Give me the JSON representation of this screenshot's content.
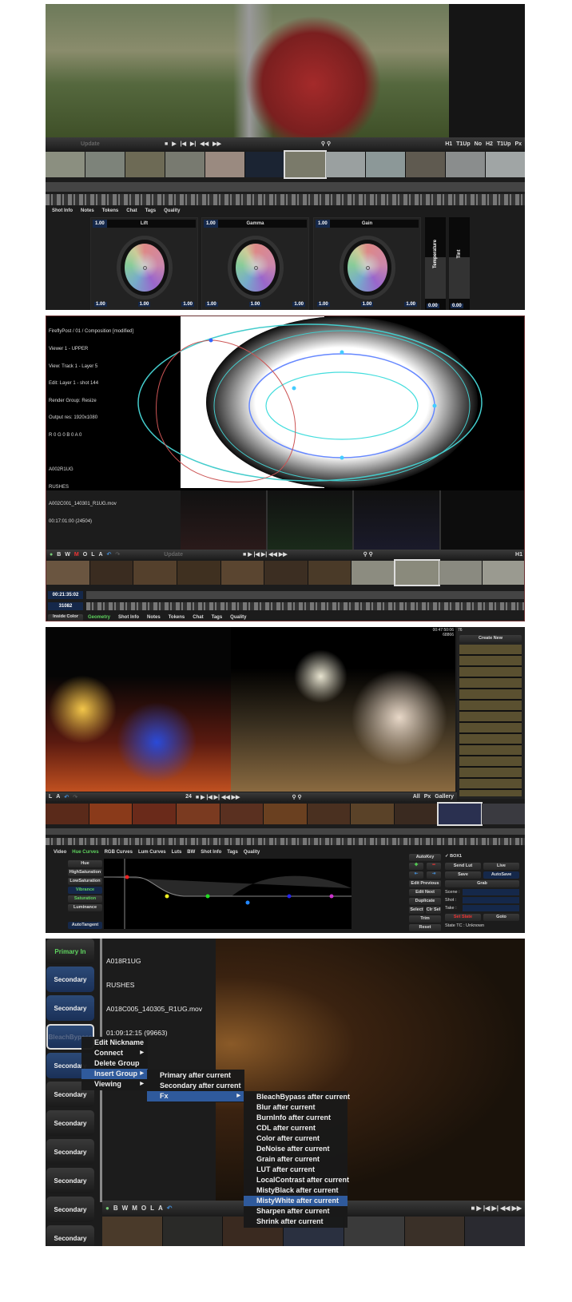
{
  "panel1": {
    "transport": [
      "■",
      "▶",
      "|◀",
      "▶|",
      "◀◀",
      "▶▶"
    ],
    "right_controls": [
      "H1",
      "T1Up",
      "No",
      "H2",
      "T1Up",
      "Px"
    ],
    "update_label": "Update",
    "tabs": [
      "Shot Info",
      "Notes",
      "Tokens",
      "Chat",
      "Tags",
      "Quality"
    ],
    "wheels": [
      {
        "title": "Lift",
        "value": "1.00",
        "r": "1.00",
        "g": "1.00",
        "b": "1.00"
      },
      {
        "title": "Gamma",
        "value": "1.00",
        "r": "1.00",
        "g": "1.00",
        "b": "1.00"
      },
      {
        "title": "Gain",
        "value": "1.00",
        "r": "1.00",
        "g": "1.00",
        "b": "1.00"
      }
    ],
    "sliders": [
      {
        "label": "Temperature",
        "value": "0.00"
      },
      {
        "label": "Tint",
        "value": "0.00"
      }
    ]
  },
  "panel2": {
    "info": [
      "FireflyPost / 01 / Composition [modified]",
      "Viewer 1 - UPPER",
      "View: Track 1 - Layer 5",
      "Edit: Layer 1 - shot 144",
      "Render Group: Resize",
      "Output res: 1920x1080",
      "R 0 G 0 B 0 A 0",
      "",
      "A002R1UG",
      "RUSHES",
      "A002C001_140301_R1UG.mov",
      "00:17:01:00 (24504)"
    ],
    "toolbar": [
      "B",
      "W",
      "M",
      "O",
      "L",
      "A"
    ],
    "update_label": "Update",
    "timecode": "00:21:35:02",
    "frame": "31082",
    "inside_color": "Inside Color",
    "tabs": [
      "Geometry",
      "Shot Info",
      "Notes",
      "Tokens",
      "Chat",
      "Tags",
      "Quality"
    ],
    "right_label": "H1"
  },
  "panel3": {
    "timecode": "00:47:50:06",
    "frames": "68866",
    "gallery_count": "76",
    "create_new": "Create New",
    "frame_num": "24",
    "toolbar_right": [
      "All",
      "Px",
      "Gallery"
    ],
    "tabs": [
      "Video",
      "Hue Curves",
      "RGB Curves",
      "Lum Curves",
      "Luts",
      "BW",
      "Shot Info",
      "Tags",
      "Quality"
    ],
    "curve_buttons": [
      "Hue",
      "HighSaturation",
      "LowSaturation",
      "Vibrance",
      "Saturation",
      "Luminance",
      "AutoTangent"
    ],
    "right_buttons": [
      "AutoKey",
      "Edit Previous",
      "Edit Next",
      "Duplicate",
      "Select",
      "Clr Sel",
      "Trim",
      "Reset"
    ],
    "box_label": "BOX1",
    "actions": [
      "Send Lut",
      "Live",
      "Save",
      "AutoSave",
      "Grab"
    ],
    "fields": [
      "Scene :",
      "Shot :",
      "Take :"
    ],
    "set_slate": "Set Slate",
    "goto": "Goto",
    "state": "State TC : Unknown"
  },
  "panel4": {
    "groups": [
      "Primary In",
      "Secondary",
      "Secondary",
      "BleachBypass",
      "Secondary",
      "Secondary",
      "Secondary",
      "Secondary",
      "Secondary",
      "Secondary",
      "Secondary"
    ],
    "info": [
      "A018R1UG",
      "RUSHES",
      "A018C005_140305_R1UG.mov",
      "01:09:12:15 (99663)"
    ],
    "context_menu": [
      "Edit Nickname",
      "Connect",
      "Delete Group",
      "Insert Group",
      "Viewing"
    ],
    "insert_submenu": [
      "Primary after current",
      "Secondary after current",
      "Fx"
    ],
    "fx_submenu": [
      "BleachBypass after current",
      "Blur after current",
      "BurnInfo after current",
      "CDL after current",
      "Color after current",
      "DeNoise after current",
      "Grain after current",
      "LUT after current",
      "LocalContrast after current",
      "MistyBlack after current",
      "MistyWhite after current",
      "Sharpen after current",
      "Shrink after current"
    ],
    "toolbar": [
      "B",
      "W",
      "M",
      "O",
      "L",
      "A"
    ]
  }
}
